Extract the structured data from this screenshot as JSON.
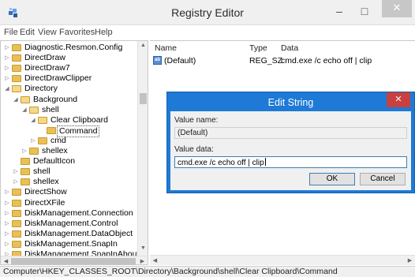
{
  "window": {
    "title": "Registry Editor",
    "minimize_glyph": "–",
    "maximize_glyph": "□",
    "close_glyph": "✕"
  },
  "menu": [
    "File",
    "Edit",
    "View",
    "Favorites",
    "Help"
  ],
  "tree": [
    {
      "label": "Diagnostic.Resmon.Config",
      "level": 0,
      "expander": "closed"
    },
    {
      "label": "DirectDraw",
      "level": 0,
      "expander": "closed"
    },
    {
      "label": "DirectDraw7",
      "level": 0,
      "expander": "closed"
    },
    {
      "label": "DirectDrawClipper",
      "level": 0,
      "expander": "closed"
    },
    {
      "label": "Directory",
      "level": 0,
      "expander": "open"
    },
    {
      "label": "Background",
      "level": 1,
      "expander": "open"
    },
    {
      "label": "shell",
      "level": 2,
      "expander": "open"
    },
    {
      "label": "Clear Clipboard",
      "level": 3,
      "expander": "open"
    },
    {
      "label": "Command",
      "level": 4,
      "expander": "none",
      "selected": true
    },
    {
      "label": "cmd",
      "level": 3,
      "expander": "closed"
    },
    {
      "label": "shellex",
      "level": 2,
      "expander": "closed"
    },
    {
      "label": "DefaultIcon",
      "level": 1,
      "expander": "none"
    },
    {
      "label": "shell",
      "level": 1,
      "expander": "closed"
    },
    {
      "label": "shellex",
      "level": 1,
      "expander": "closed"
    },
    {
      "label": "DirectShow",
      "level": 0,
      "expander": "closed"
    },
    {
      "label": "DirectXFile",
      "level": 0,
      "expander": "closed"
    },
    {
      "label": "DiskManagement.Connection",
      "level": 0,
      "expander": "closed"
    },
    {
      "label": "DiskManagement.Control",
      "level": 0,
      "expander": "closed"
    },
    {
      "label": "DiskManagement.DataObject",
      "level": 0,
      "expander": "closed"
    },
    {
      "label": "DiskManagement.SnapIn",
      "level": 0,
      "expander": "closed"
    },
    {
      "label": "DiskManagement.SnapInAbout",
      "level": 0,
      "expander": "closed"
    }
  ],
  "list": {
    "columns": {
      "name": "Name",
      "type": "Type",
      "data": "Data"
    },
    "rows": [
      {
        "icon": "ab",
        "name": "(Default)",
        "type": "REG_SZ",
        "data": "cmd.exe /c echo off | clip"
      }
    ]
  },
  "status_path": "Computer\\HKEY_CLASSES_ROOT\\Directory\\Background\\shell\\Clear Clipboard\\Command",
  "dialog": {
    "title": "Edit String",
    "close_glyph": "✕",
    "value_name_label": "Value name:",
    "value_name": "(Default)",
    "value_data_label": "Value data:",
    "value_data_before_caret": "cmd.exe /c echo off | clip",
    "ok_label": "OK",
    "cancel_label": "Cancel"
  },
  "colors": {
    "dialog_accent": "#1e7ad6",
    "dialog_close": "#c84040",
    "folder": "#e8c056"
  }
}
